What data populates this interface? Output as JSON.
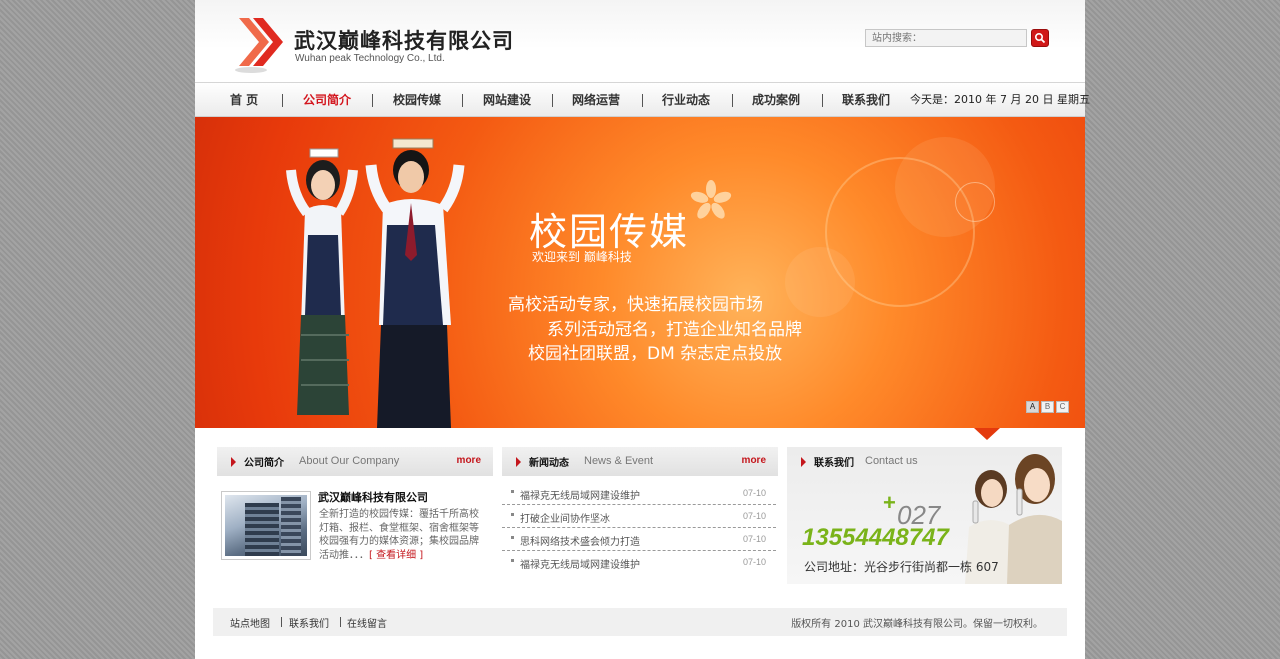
{
  "header": {
    "company_cn": "武汉巅峰科技有限公司",
    "company_en": "Wuhan peak Technology Co., Ltd.",
    "search_placeholder": "站内搜索：",
    "search_icon": "search-icon"
  },
  "nav": {
    "items": [
      {
        "label": "首  页",
        "active": false
      },
      {
        "label": "公司简介",
        "active": true
      },
      {
        "label": "校园传媒",
        "active": false
      },
      {
        "label": "网站建设",
        "active": false
      },
      {
        "label": "网络运营",
        "active": false
      },
      {
        "label": "行业动态",
        "active": false
      },
      {
        "label": "成功案例",
        "active": false
      },
      {
        "label": "联系我们",
        "active": false
      }
    ],
    "date": "今天是：2010 年 7 月 20 日 星期五"
  },
  "banner": {
    "title": "校园传媒",
    "subtitle": "欢迎来到 巅峰科技",
    "lines": [
      "高校活动专家，快速拓展校园市场",
      "系列活动冠名，打造企业知名品牌",
      "校园社团联盟，DM 杂志定点投放"
    ],
    "slides": [
      "A",
      "B",
      "C"
    ],
    "active_slide": 0,
    "colors": {
      "primary": "#f45a12",
      "highlight": "#ffb35a"
    }
  },
  "about": {
    "title_cn": "公司简介",
    "title_en": "About Our Company",
    "more": "more",
    "company": "武汉巅峰科技有限公司",
    "text": "全新打造的校园传媒：覆括千所高校灯箱、报栏、食堂框架、宿舍框架等校园强有力的媒体资源；集校园品牌活动推．．．",
    "detail": "[ 查看详细 ]"
  },
  "news": {
    "title_cn": "新闻动态",
    "title_en": "News & Event",
    "more": "more",
    "items": [
      {
        "title": "福禄克无线局域网建设维护",
        "date": "07-10"
      },
      {
        "title": "打破企业间协作坚冰",
        "date": "07-10"
      },
      {
        "title": "思科网络技术盛会倾力打造",
        "date": "07-10"
      },
      {
        "title": "福禄克无线局域网建设维护",
        "date": "07-10"
      }
    ]
  },
  "contact": {
    "title_cn": "联系我们",
    "title_en": "Contact us",
    "plus": "+",
    "area_code": "027",
    "phone": "13554448747",
    "address": "公司地址：光谷步行街尚都一栋 607"
  },
  "footer": {
    "links": [
      "站点地图",
      "联系我们",
      "在线留言"
    ],
    "copyright": "版权所有  2010  武汉巅峰科技有限公司。保留一切权利。"
  },
  "colors": {
    "accent_red": "#c4161c",
    "green": "#7ab319",
    "background_gray": "#9a9a9a"
  }
}
